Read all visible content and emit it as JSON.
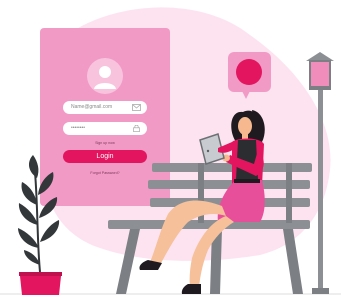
{
  "login_form": {
    "email_placeholder": "Name@gmail.com",
    "password_value": "••••••••",
    "signup_link": "Sign up now",
    "login_button": "Login",
    "forgot_link": "Forgot Password?"
  },
  "colors": {
    "background_blob": "#fde3f0",
    "card": "#f29ac6",
    "accent": "#e3155f",
    "bench": "#8c9094",
    "plant": "#33373a",
    "pot": "#e3155f",
    "lamp_post": "#8c9094",
    "lamp_glass": "#f08dbb"
  },
  "icons": [
    "user-icon",
    "mail-icon",
    "lock-icon",
    "chat-bubble-icon",
    "tablet-icon"
  ]
}
